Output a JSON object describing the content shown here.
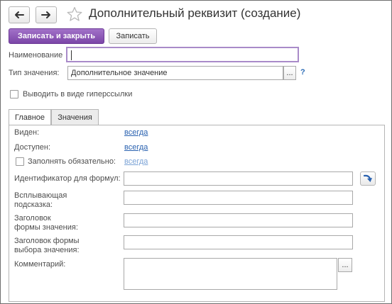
{
  "window": {
    "title": "Дополнительный реквизит (создание)"
  },
  "toolbar": {
    "back_icon": "arrow-left-icon",
    "forward_icon": "arrow-right-icon",
    "favorite_icon": "star-outline-icon",
    "save_close_label": "Записать и закрыть",
    "save_label": "Записать"
  },
  "form": {
    "name_label": "Наименование",
    "name_value": "",
    "type_label": "Тип значения:",
    "type_value": "Дополнительное значение",
    "type_select_label": "...",
    "help_label": "?",
    "hyperlink_label": "Выводить в виде гиперссылки",
    "hyperlink_checked": false
  },
  "tabs": [
    {
      "label": "Главное",
      "active": true
    },
    {
      "label": "Значения",
      "active": false
    }
  ],
  "main_tab": {
    "visible_label": "Виден:",
    "visible_value": "всегда",
    "available_label": "Доступен:",
    "available_value": "всегда",
    "required_label": "Заполнять обязательно:",
    "required_value": "всегда",
    "required_checked": false,
    "formula_id_label": "Идентификатор для формул:",
    "formula_id_value": "",
    "refresh_icon": "refresh-arrow-icon",
    "tooltip_label_1": "Всплывающая",
    "tooltip_label_2": "подсказка:",
    "tooltip_value": "",
    "value_form_title_label_1": "Заголовок",
    "value_form_title_label_2": "формы значения:",
    "value_form_title_value": "",
    "choice_form_title_label_1": "Заголовок формы",
    "choice_form_title_label_2": "выбора значения:",
    "choice_form_title_value": "",
    "comment_label": "Комментарий:",
    "comment_value": "",
    "comment_expand_label": "..."
  },
  "colors": {
    "accent": "#7b46a8",
    "link": "#2a62b0",
    "focus": "#a98bc9"
  }
}
